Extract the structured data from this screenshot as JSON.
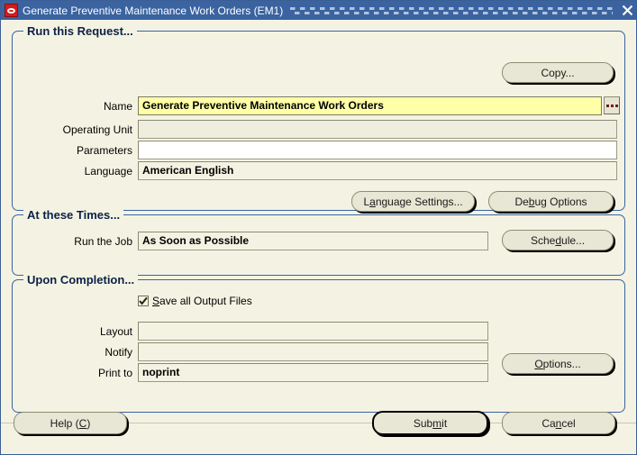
{
  "window": {
    "title": "Generate Preventive Maintenance Work Orders (EM1)",
    "icon": "oracle-logo-icon",
    "close_icon": "close-icon",
    "titlebar_color": "#3a63a0",
    "background_color": "#f4f3e3",
    "border_color": "#3a63a0"
  },
  "run_request": {
    "group_title": "Run this Request...",
    "copy_button": "Copy...",
    "fields": [
      {
        "label": "Name",
        "value": "Generate Preventive Maintenance Work Orders",
        "state": "focus",
        "lov": true
      },
      {
        "label": "Operating Unit",
        "value": "",
        "state": "disabled",
        "lov": false
      },
      {
        "label": "Parameters",
        "value": "",
        "state": "white",
        "lov": false
      },
      {
        "label": "Language",
        "value": "American English",
        "state": "readonly",
        "lov": false
      }
    ],
    "language_settings_button": {
      "pre": "L",
      "accel": "a",
      "post": "nguage Settings..."
    },
    "debug_options_button": {
      "pre": "De",
      "accel": "b",
      "post": "ug Options"
    }
  },
  "at_these_times": {
    "group_title": "At these Times...",
    "field": {
      "label": "Run the Job",
      "value": "As Soon as Possible",
      "state": "readonly"
    },
    "schedule_button": {
      "pre": "Sche",
      "accel": "d",
      "post": "ule..."
    }
  },
  "upon_completion": {
    "group_title": "Upon Completion...",
    "save_checkbox": {
      "checked": true,
      "pre": "",
      "accel": "S",
      "post": "ave all Output Files"
    },
    "fields": [
      {
        "label": "Layout",
        "value": "",
        "state": "readonly"
      },
      {
        "label": "Notify",
        "value": "",
        "state": "readonly"
      },
      {
        "label": "Print to",
        "value": "noprint",
        "state": "readonly"
      }
    ],
    "options_button": {
      "pre": "",
      "accel": "O",
      "post": "ptions..."
    }
  },
  "footer": {
    "help_button": {
      "pre": "Help (",
      "accel": "C",
      "post": ")"
    },
    "submit_button": {
      "pre": "Sub",
      "accel": "m",
      "post": "it"
    },
    "cancel_button": {
      "pre": "Ca",
      "accel": "n",
      "post": "cel"
    }
  }
}
